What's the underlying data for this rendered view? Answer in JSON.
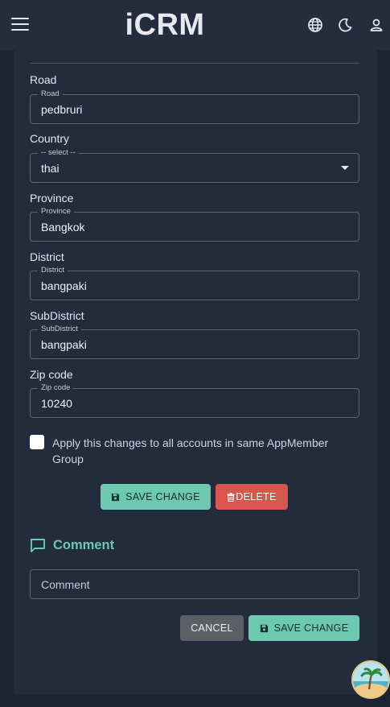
{
  "app": {
    "title": "iCRM"
  },
  "header_icons": {
    "menu": "menu-icon",
    "language": "globe-icon",
    "theme": "moon-icon",
    "account": "person-icon"
  },
  "form": {
    "road": {
      "section_label": "Road",
      "field_label": "Road",
      "value": "pedbruri"
    },
    "country": {
      "section_label": "Country",
      "field_label": "-- select --",
      "value": "thai"
    },
    "province": {
      "section_label": "Province",
      "field_label": "Province",
      "value": "Bangkok"
    },
    "district": {
      "section_label": "District",
      "field_label": "District",
      "value": "bangpaki"
    },
    "subdistrict": {
      "section_label": "SubDistrict",
      "field_label": "SubDistrict",
      "value": "bangpaki"
    },
    "zipcode": {
      "section_label": "Zip code",
      "field_label": "Zip code",
      "value": "10240"
    }
  },
  "apply_checkbox": {
    "label": "Apply this changes to all accounts in same AppMember Group",
    "checked": false
  },
  "actions": {
    "save_label": "SAVE CHANGE",
    "delete_label": "DELETE"
  },
  "comment": {
    "title": "Comment",
    "placeholder": "Comment",
    "cancel_label": "CANCEL",
    "save_label": "SAVE CHANGE"
  },
  "colors": {
    "accent": "#6cc8ae",
    "danger": "#d9554d",
    "background": "#1b2433",
    "card": "#222c3d"
  }
}
